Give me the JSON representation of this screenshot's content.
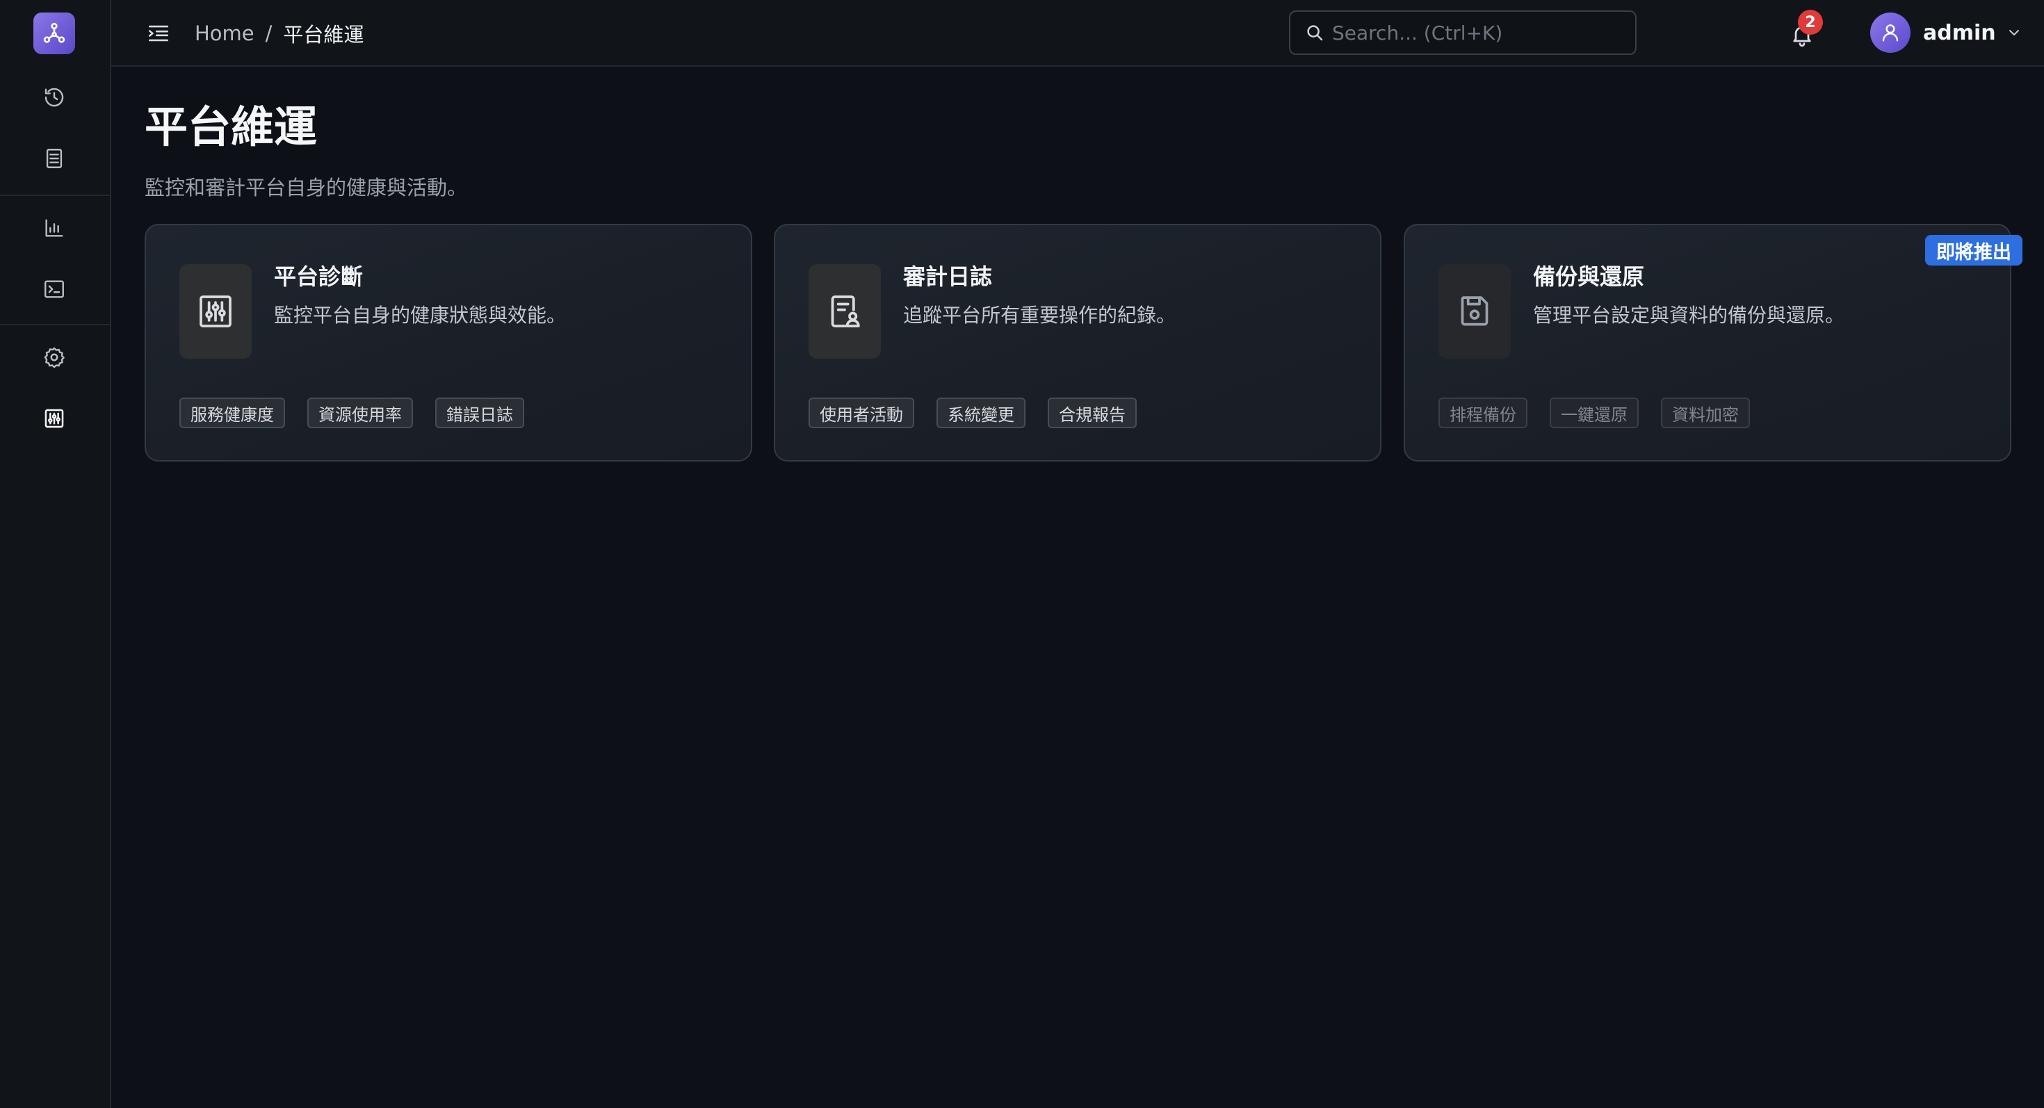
{
  "topbar": {
    "breadcrumb": {
      "home": "Home",
      "separator": "/",
      "current": "平台維運"
    },
    "search": {
      "placeholder": "Search... (Ctrl+K)",
      "value": ""
    },
    "notifications": {
      "count": "2"
    },
    "user": {
      "name": "admin"
    }
  },
  "page": {
    "title": "平台維運",
    "description": "監控和審計平台自身的健康與活動。"
  },
  "cards": [
    {
      "title": "平台診斷",
      "description": "監控平台自身的健康狀態與效能。",
      "icon": "sliders-icon",
      "tags": [
        "服務健康度",
        "資源使用率",
        "錯誤日誌"
      ]
    },
    {
      "title": "審計日誌",
      "description": "追蹤平台所有重要操作的紀錄。",
      "icon": "audit-document-icon",
      "tags": [
        "使用者活動",
        "系統變更",
        "合規報告"
      ]
    },
    {
      "title": "備份與還原",
      "description": "管理平台設定與資料的備份與還原。",
      "icon": "save-disk-icon",
      "badge": "即將推出",
      "tags": [
        "排程備份",
        "一鍵還原",
        "資料加密"
      ]
    }
  ],
  "colors": {
    "accent": "#6b58d6",
    "badge_blue": "#2d6fe0",
    "notification_red": "#e03a3a",
    "background": "#0d1016"
  }
}
